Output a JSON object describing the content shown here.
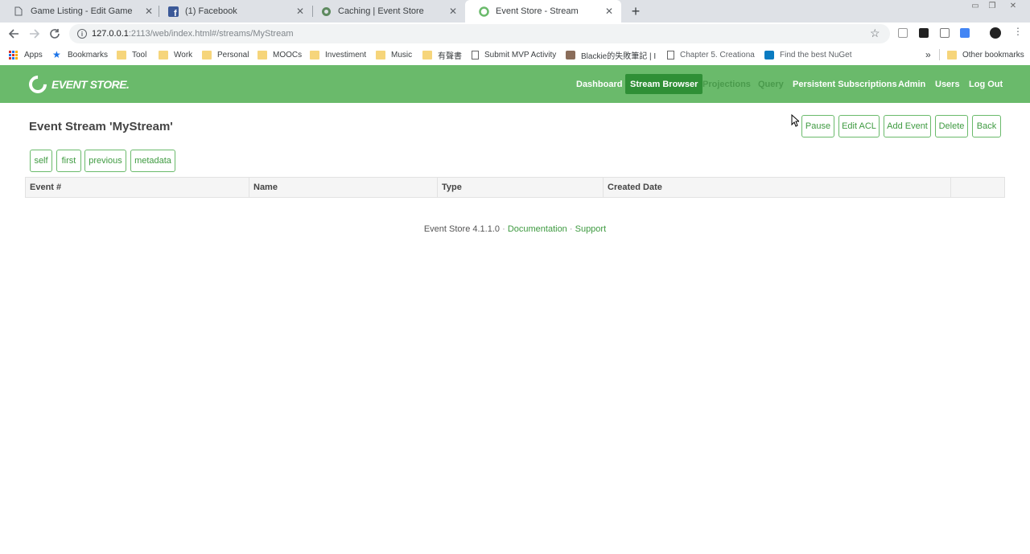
{
  "browser": {
    "tabs": [
      {
        "title": "Game Listing - Edit Game",
        "icon": "page-icon"
      },
      {
        "title": "(1) Facebook",
        "icon": "facebook-icon"
      },
      {
        "title": "Caching | Event Store",
        "icon": "eventstore-icon"
      },
      {
        "title": "Event Store - Stream",
        "icon": "eventstore-icon"
      }
    ],
    "url_host": "127.0.0.1",
    "url_path": ":2113/web/index.html#/streams/MyStream",
    "bookmarks": [
      {
        "label": "Apps",
        "icon": "apps-icon"
      },
      {
        "label": "Bookmarks",
        "icon": "star-icon"
      },
      {
        "label": "Tool",
        "icon": "folder-icon"
      },
      {
        "label": "Work",
        "icon": "folder-icon"
      },
      {
        "label": "Personal",
        "icon": "folder-icon"
      },
      {
        "label": "MOOCs",
        "icon": "folder-icon"
      },
      {
        "label": "Investiment",
        "icon": "folder-icon"
      },
      {
        "label": "Music",
        "icon": "folder-icon"
      },
      {
        "label": "有聲書",
        "icon": "folder-icon"
      },
      {
        "label": "Submit MVP Activity",
        "icon": "page-icon"
      },
      {
        "label": "Blackie的失敗筆記 | I",
        "icon": "avatar-icon"
      },
      {
        "label": "Chapter 5. Creationa",
        "icon": "page-icon"
      },
      {
        "label": "Find the best NuGet",
        "icon": "nuget-icon"
      },
      {
        "label": "Other bookmarks",
        "icon": "folder-icon"
      }
    ],
    "overflow": "»"
  },
  "app": {
    "logo": "EVENT STORE.",
    "nav": [
      "Dashboard",
      "Stream Browser",
      "Projections",
      "Query",
      "Persistent Subscriptions",
      "Admin",
      "Users",
      "Log Out"
    ],
    "title": "Event Stream 'MyStream'",
    "actions": [
      "Pause",
      "Edit ACL",
      "Add Event",
      "Delete",
      "Back"
    ],
    "links": [
      "self",
      "first",
      "previous",
      "metadata"
    ],
    "columns": [
      "Event #",
      "Name",
      "Type",
      "Created Date"
    ],
    "footer": {
      "version": "Event Store 4.1.1.0",
      "sep": "·",
      "documentation": "Documentation",
      "support": "Support"
    }
  },
  "colors": {
    "header_green": "#6aba6b",
    "active_nav": "#2f8f36",
    "link_green": "#3e9a40"
  }
}
